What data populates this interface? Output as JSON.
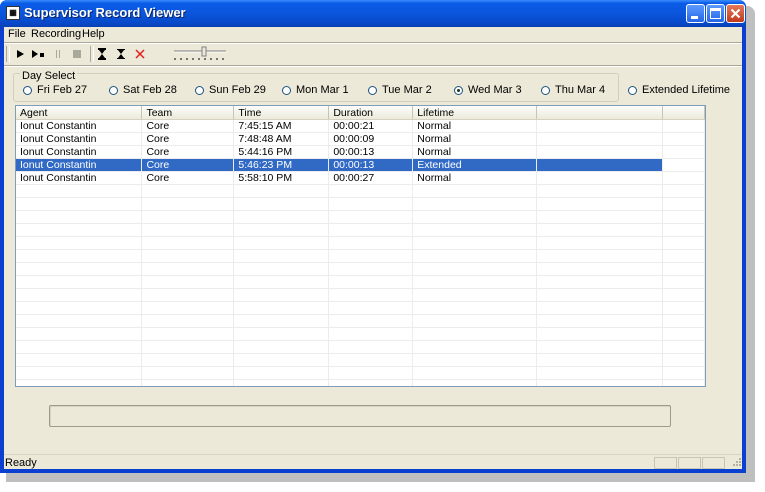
{
  "window": {
    "title": "Supervisor Record Viewer"
  },
  "menu": [
    {
      "label": "File"
    },
    {
      "label": "Recording"
    },
    {
      "label": "Help"
    }
  ],
  "toolbar": {
    "buttons": [
      {
        "icon": "play-icon",
        "enabled": true
      },
      {
        "icon": "play-stop-icon",
        "enabled": true
      },
      {
        "icon": "pause-icon",
        "enabled": false
      },
      {
        "icon": "stop-icon",
        "enabled": false
      },
      {
        "icon": "hourglass-icon",
        "enabled": true
      },
      {
        "icon": "hourglass-small-icon",
        "enabled": true
      },
      {
        "icon": "delete-icon",
        "enabled": true,
        "color": "#e02020"
      }
    ],
    "slider": {
      "icon": "volume-slider"
    }
  },
  "day_select": {
    "title": "Day Select",
    "options": [
      {
        "label": "Fri Feb 27",
        "selected": false
      },
      {
        "label": "Sat Feb 28",
        "selected": false
      },
      {
        "label": "Sun Feb 29",
        "selected": false
      },
      {
        "label": "Mon Mar 1",
        "selected": false
      },
      {
        "label": "Tue Mar 2",
        "selected": false
      },
      {
        "label": "Wed Mar 3",
        "selected": true
      },
      {
        "label": "Thu Mar 4",
        "selected": false
      }
    ],
    "extended": {
      "label": "Extended Lifetime",
      "selected": false
    }
  },
  "table": {
    "columns": [
      "Agent",
      "Team",
      "Time",
      "Duration",
      "Lifetime",
      ""
    ],
    "rows": [
      [
        "Ionut Constantin",
        "Core",
        "7:45:15 AM",
        "00:00:21",
        "Normal",
        ""
      ],
      [
        "Ionut Constantin",
        "Core",
        "7:48:48 AM",
        "00:00:09",
        "Normal",
        ""
      ],
      [
        "Ionut Constantin",
        "Core",
        "5:44:16 PM",
        "00:00:13",
        "Normal",
        ""
      ],
      [
        "Ionut Constantin",
        "Core",
        "5:46:23 PM",
        "00:00:13",
        "Extended",
        ""
      ],
      [
        "Ionut Constantin",
        "Core",
        "5:58:10 PM",
        "00:00:27",
        "Normal",
        ""
      ]
    ],
    "selected_row": 3,
    "selection_color": "#316ac5"
  },
  "status": {
    "text": "Ready"
  }
}
